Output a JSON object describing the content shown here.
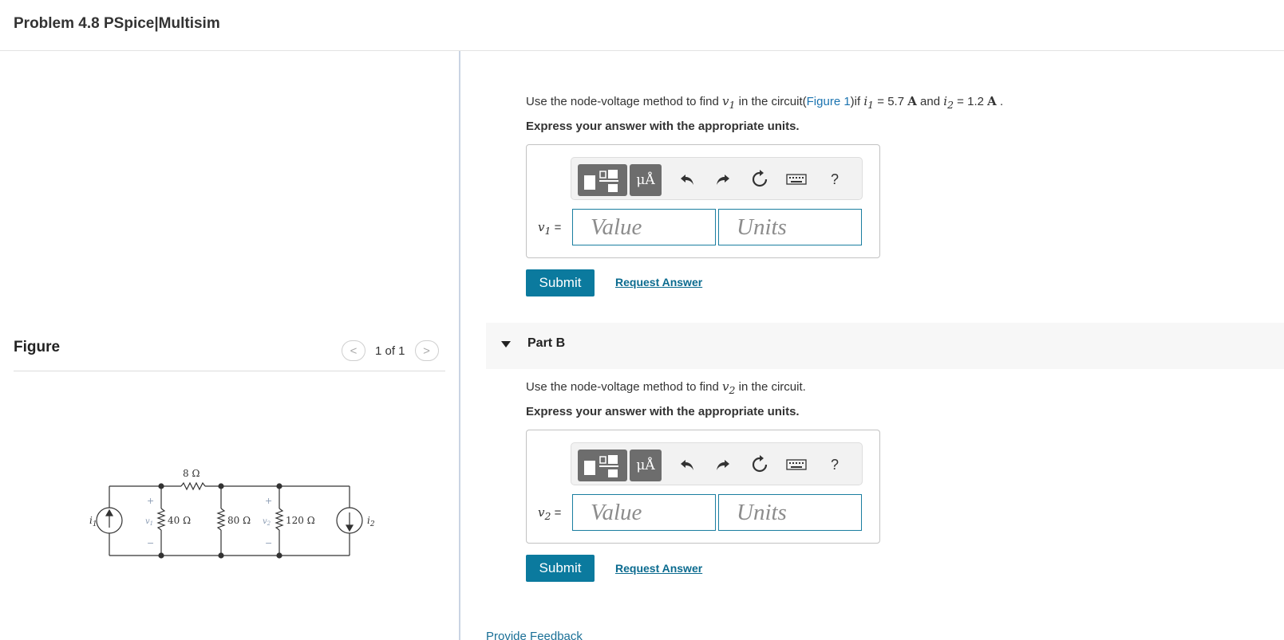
{
  "header": {
    "title": "Problem 4.8 PSpice|Multisim"
  },
  "figure": {
    "label": "Figure",
    "pager": {
      "prev": "<",
      "next": ">",
      "text": "1 of 1"
    },
    "circuit": {
      "source1": "i",
      "source1_sub": "1",
      "source2": "i",
      "source2_sub": "2",
      "r_series": "8 Ω",
      "r1": "40 Ω",
      "r2": "80 Ω",
      "r3": "120 Ω",
      "v1": "v",
      "v1_sub": "1",
      "v2": "v",
      "v2_sub": "2",
      "plus": "+",
      "minus": "−"
    }
  },
  "part_a": {
    "q_pre": "Use the node-voltage method to find ",
    "q_var": "v",
    "q_var_sub": "1",
    "q_mid": " in the circuit(",
    "q_link": "Figure 1",
    "q_if": ")if ",
    "i1": "i",
    "i1_sub": "1",
    "i1_val": " = 5.7 ",
    "unit_a": "A",
    "and": " and ",
    "i2": "i",
    "i2_sub": "2",
    "i2_val": " = 1.2 ",
    "period": " .",
    "instruction": "Express your answer with the appropriate units.",
    "var_label": "v",
    "var_sub": "1",
    "equals": " =",
    "value_placeholder": "Value",
    "units_placeholder": "Units",
    "submit": "Submit",
    "request": "Request Answer"
  },
  "part_b": {
    "title": "Part B",
    "q_pre": "Use the node-voltage method to find ",
    "q_var": "v",
    "q_var_sub": "2",
    "q_post": " in the circuit.",
    "instruction": "Express your answer with the appropriate units.",
    "var_label": "v",
    "var_sub": "2",
    "equals": " =",
    "value_placeholder": "Value",
    "units_placeholder": "Units",
    "submit": "Submit",
    "request": "Request Answer"
  },
  "toolbar": {
    "mu_label": "μÅ",
    "help_label": "?"
  },
  "feedback": "Provide Feedback"
}
